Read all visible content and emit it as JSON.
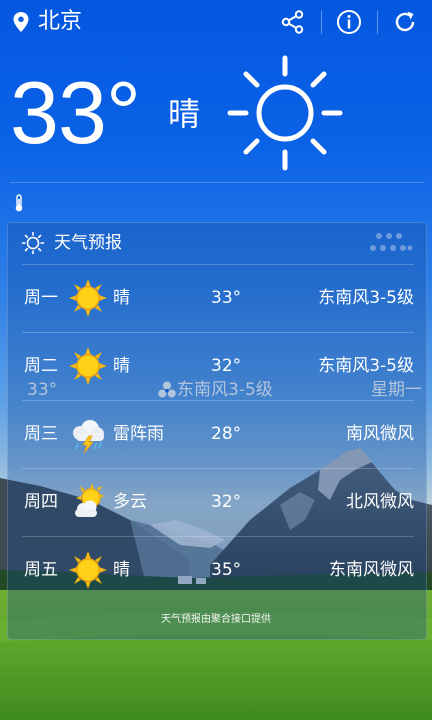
{
  "header": {
    "city": "北京",
    "location_icon": "location-pin-icon",
    "share_icon": "share-icon",
    "info_icon": "info-icon",
    "refresh_icon": "refresh-icon"
  },
  "current": {
    "temperature": "33°",
    "condition": "晴",
    "condition_icon": "sun-icon"
  },
  "info_row": {
    "temperature": "33°",
    "wind": "东南风3-5级",
    "weekday": "星期一"
  },
  "forecast": {
    "title": "天气预报",
    "days": [
      {
        "day": "周一",
        "icon": "sunny-icon",
        "condition": "晴",
        "temp": "33°",
        "wind": "东南风3-5级"
      },
      {
        "day": "周二",
        "icon": "sunny-icon",
        "condition": "晴",
        "temp": "32°",
        "wind": "东南风3-5级"
      },
      {
        "day": "周三",
        "icon": "thunderstorm-icon",
        "condition": "雷阵雨",
        "temp": "28°",
        "wind": "南风微风"
      },
      {
        "day": "周四",
        "icon": "partly-cloudy-icon",
        "condition": "多云",
        "temp": "32°",
        "wind": "北风微风"
      },
      {
        "day": "周五",
        "icon": "sunny-icon",
        "condition": "晴",
        "temp": "35°",
        "wind": "东南风微风"
      }
    ],
    "credit": "天气预报由聚合接口提供"
  },
  "colors": {
    "sky_top": "#0457e0",
    "grass": "#5aa52a",
    "sun_yellow": "#ffd21a"
  }
}
